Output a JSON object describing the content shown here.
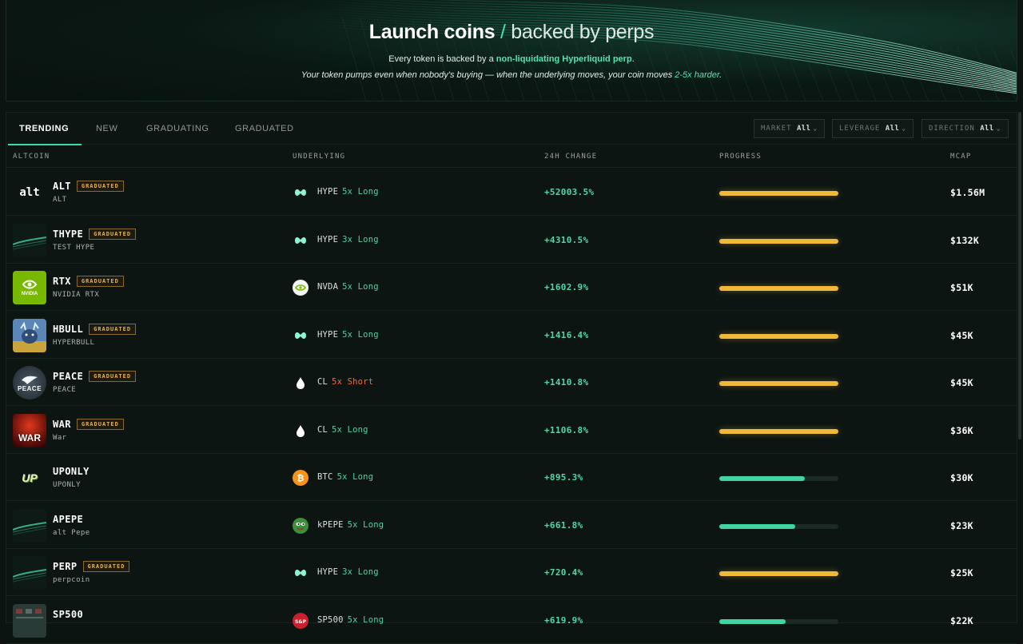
{
  "hero": {
    "title_main": "Launch coins",
    "title_slash": "/",
    "title_sub": "backed by perps",
    "line1_pre": "Every token is backed by a",
    "line1_accent": "non-liquidating Hyperliquid perp",
    "line1_post": ".",
    "line2_pre": "Your token pumps even when nobody's buying — when the underlying moves, your coin moves",
    "line2_accent": "2-5x harder",
    "line2_post": "."
  },
  "tabs": [
    "TRENDING",
    "NEW",
    "GRADUATING",
    "GRADUATED"
  ],
  "active_tab": "TRENDING",
  "filters": [
    {
      "label": "MARKET",
      "value": "All"
    },
    {
      "label": "LEVERAGE",
      "value": "All"
    },
    {
      "label": "DIRECTION",
      "value": "All"
    }
  ],
  "columns": {
    "altcoin": "ALTCOIN",
    "underlying": "UNDERLYING",
    "change": "24H CHANGE",
    "progress": "PROGRESS",
    "mcap": "MCAP"
  },
  "badge_label": "GRADUATED",
  "rows": [
    {
      "symbol": "ALT",
      "name": "ALT",
      "graduated": true,
      "avatar": "alt-logo",
      "avatar_text": "alt",
      "underlying": "HYPE",
      "underlying_icon": "hype-icon",
      "leverage": "5x Long",
      "direction": "long",
      "change": "+52003.5%",
      "progress": 1.0,
      "mcap": "$1.56M"
    },
    {
      "symbol": "THYPE",
      "name": "TEST HYPE",
      "graduated": true,
      "avatar": "wave-thumbnail",
      "avatar_text": "",
      "underlying": "HYPE",
      "underlying_icon": "hype-icon",
      "leverage": "3x Long",
      "direction": "long",
      "change": "+4310.5%",
      "progress": 1.0,
      "mcap": "$132K"
    },
    {
      "symbol": "RTX",
      "name": "NVIDIA RTX",
      "graduated": true,
      "avatar": "nvidia-logo",
      "avatar_text": "NVIDIA",
      "underlying": "NVDA",
      "underlying_icon": "nvidia-icon",
      "leverage": "5x Long",
      "direction": "long",
      "change": "+1602.9%",
      "progress": 1.0,
      "mcap": "$51K"
    },
    {
      "symbol": "HBULL",
      "name": "HYPERBULL",
      "graduated": true,
      "avatar": "bull-art",
      "avatar_text": "",
      "underlying": "HYPE",
      "underlying_icon": "hype-icon",
      "leverage": "5x Long",
      "direction": "long",
      "change": "+1416.4%",
      "progress": 1.0,
      "mcap": "$45K"
    },
    {
      "symbol": "PEACE",
      "name": "PEACE",
      "graduated": true,
      "avatar": "peace-dove",
      "avatar_text": "PEACE",
      "underlying": "CL",
      "underlying_icon": "oil-drop-icon",
      "leverage": "5x Short",
      "direction": "short",
      "change": "+1410.8%",
      "progress": 1.0,
      "mcap": "$45K"
    },
    {
      "symbol": "WAR",
      "name": "War",
      "graduated": true,
      "avatar": "war-art",
      "avatar_text": "WAR",
      "underlying": "CL",
      "underlying_icon": "oil-drop-icon",
      "leverage": "5x Long",
      "direction": "long",
      "change": "+1106.8%",
      "progress": 1.0,
      "mcap": "$36K"
    },
    {
      "symbol": "UPONLY",
      "name": "UPONLY",
      "graduated": false,
      "avatar": "uponly-logo",
      "avatar_text": "UP",
      "underlying": "BTC",
      "underlying_icon": "bitcoin-icon",
      "leverage": "5x Long",
      "direction": "long",
      "change": "+895.3%",
      "progress": 0.72,
      "mcap": "$30K"
    },
    {
      "symbol": "APEPE",
      "name": "alt Pepe",
      "graduated": false,
      "avatar": "wave-thumbnail",
      "avatar_text": "",
      "underlying": "kPEPE",
      "underlying_icon": "pepe-icon",
      "leverage": "5x Long",
      "direction": "long",
      "change": "+661.8%",
      "progress": 0.64,
      "mcap": "$23K"
    },
    {
      "symbol": "PERP",
      "name": "perpcoin",
      "graduated": true,
      "avatar": "wave-thumbnail",
      "avatar_text": "",
      "underlying": "HYPE",
      "underlying_icon": "hype-icon",
      "leverage": "3x Long",
      "direction": "long",
      "change": "+720.4%",
      "progress": 1.0,
      "mcap": "$25K"
    },
    {
      "symbol": "SP500",
      "name": "",
      "graduated": false,
      "avatar": "sp500-thumbnail",
      "avatar_text": "",
      "underlying": "SP500",
      "underlying_icon": "sp500-icon",
      "leverage": "5x Long",
      "direction": "long",
      "change": "+619.9%",
      "progress": 0.56,
      "mcap": "$22K"
    }
  ],
  "colors": {
    "accent": "#3dd9a6",
    "gold": "#f0b93a",
    "short": "#ef6b4c",
    "background": "#0b1411"
  }
}
